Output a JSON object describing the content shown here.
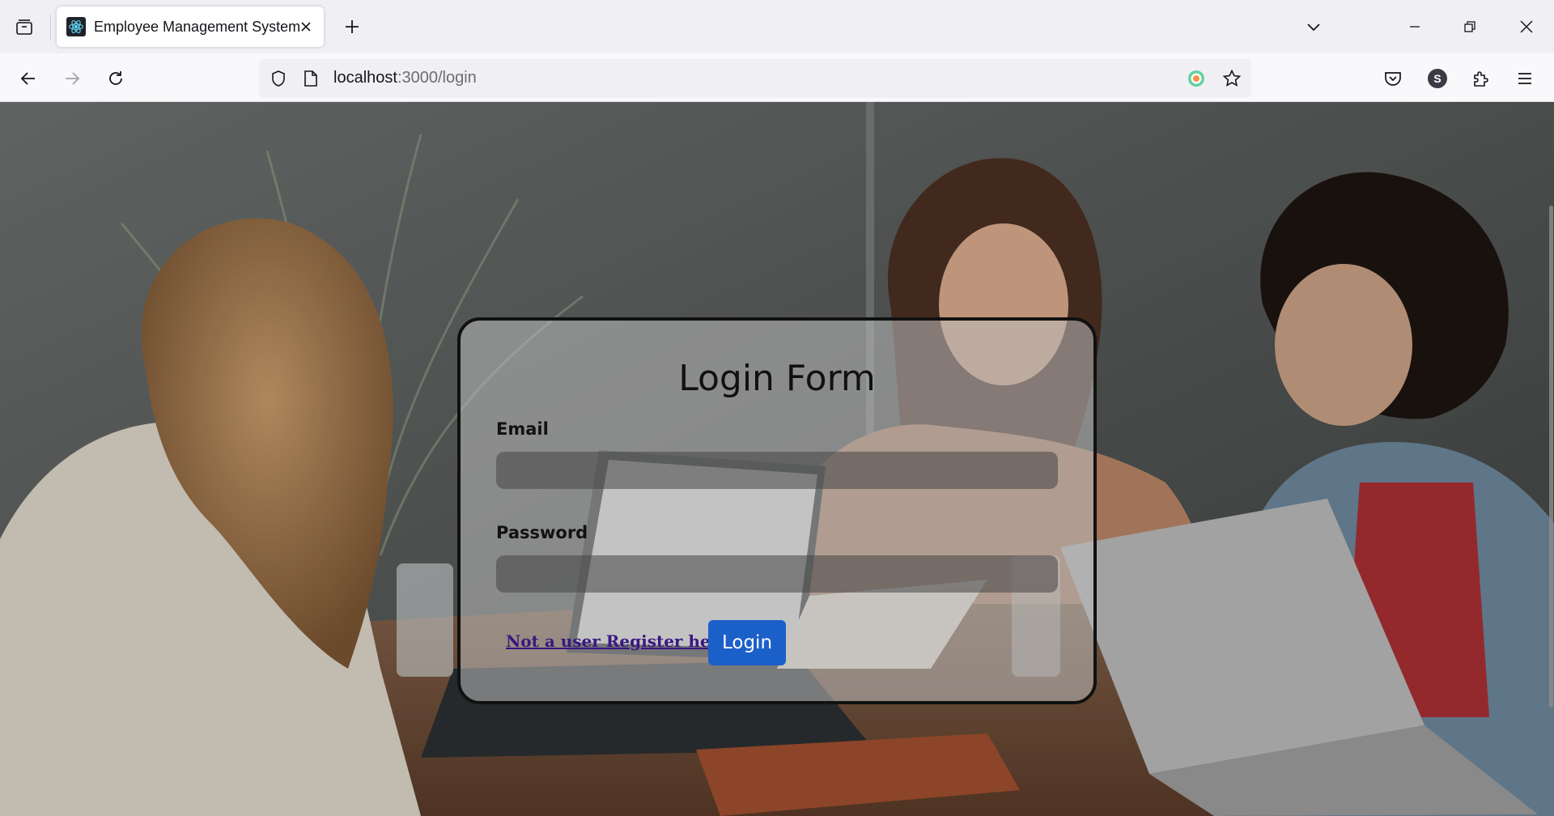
{
  "browser": {
    "tab": {
      "title": "Employee Management System"
    },
    "url": {
      "host": "localhost",
      "path": ":3000/login"
    },
    "profile_initial": "S",
    "icons": {
      "tab_list": "tab-list-icon",
      "favicon": "react-icon",
      "tab_close": "close-icon",
      "new_tab": "plus-icon",
      "list_all_tabs": "chevron-down-icon",
      "minimize": "minimize-icon",
      "restore": "restore-icon",
      "close_window": "close-icon",
      "back": "arrow-left-icon",
      "forward": "arrow-right-icon",
      "reload": "reload-icon",
      "shield": "shield-icon",
      "page": "page-icon",
      "extension_badge": "extension-badge-icon",
      "bookmark": "star-icon",
      "pocket": "pocket-icon",
      "extensions": "puzzle-icon",
      "menu": "hamburger-menu-icon"
    }
  },
  "login": {
    "title": "Login Form",
    "email_label": "Email",
    "email_value": "",
    "password_label": "Password",
    "password_value": "",
    "register_link": "Not a user Register here",
    "login_button": "Login"
  },
  "colors": {
    "login_button": "#1b5fc9",
    "register_link": "#3a1780",
    "card_border": "#111111"
  }
}
